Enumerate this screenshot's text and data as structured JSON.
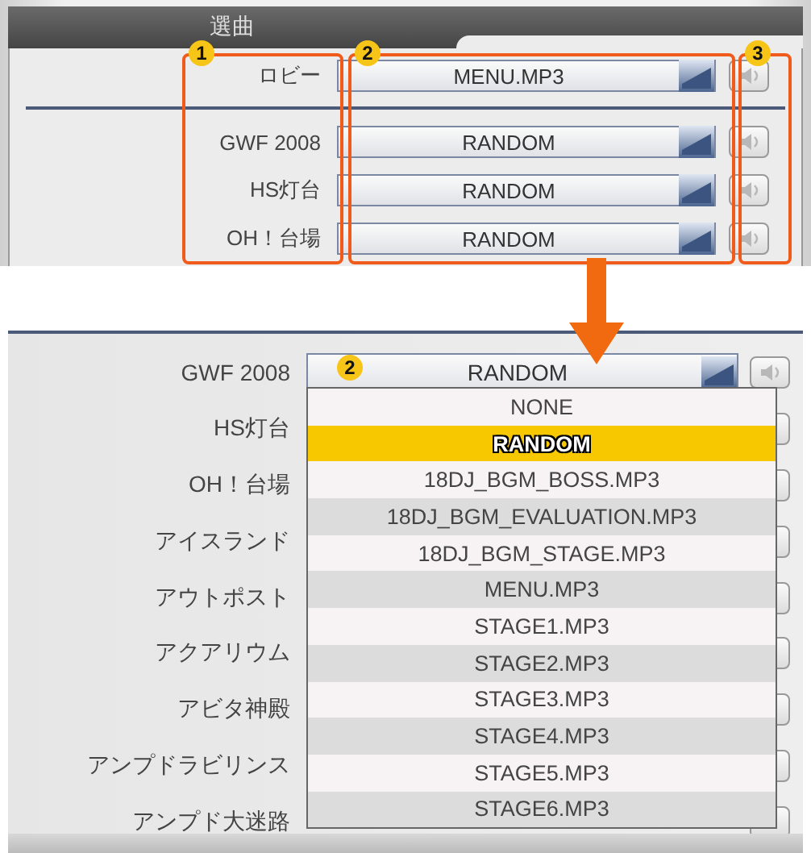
{
  "top_panel": {
    "tab": "選曲",
    "badges": [
      {
        "number": "1"
      },
      {
        "number": "2"
      },
      {
        "number": "3"
      }
    ],
    "lobby_row": {
      "label": "ロビー",
      "value": "MENU.MP3"
    },
    "stage_rows": [
      {
        "label": "GWF 2008",
        "value": "RANDOM"
      },
      {
        "label": "HS灯台",
        "value": "RANDOM"
      },
      {
        "label": "OH！台場",
        "value": "RANDOM"
      }
    ]
  },
  "bottom_panel": {
    "select": {
      "value": "RANDOM",
      "badge": "2"
    },
    "rows": [
      {
        "label": "GWF 2008"
      },
      {
        "label": "HS灯台"
      },
      {
        "label": "OH！台場"
      },
      {
        "label": "アイスランド"
      },
      {
        "label": "アウトポスト"
      },
      {
        "label": "アクアリウム"
      },
      {
        "label": "アビタ神殿"
      },
      {
        "label": "アンプドラビリンス"
      },
      {
        "label": "アンプド大迷路"
      }
    ],
    "dropdown": [
      {
        "label": "NONE",
        "selected": false
      },
      {
        "label": "RANDOM",
        "selected": true
      },
      {
        "label": "18DJ_BGM_BOSS.MP3",
        "selected": false
      },
      {
        "label": "18DJ_BGM_EVALUATION.MP3",
        "selected": false
      },
      {
        "label": "18DJ_BGM_STAGE.MP3",
        "selected": false
      },
      {
        "label": "MENU.MP3",
        "selected": false
      },
      {
        "label": "STAGE1.MP3",
        "selected": false
      },
      {
        "label": "STAGE2.MP3",
        "selected": false
      },
      {
        "label": "STAGE3.MP3",
        "selected": false
      },
      {
        "label": "STAGE4.MP3",
        "selected": false
      },
      {
        "label": "STAGE5.MP3",
        "selected": false
      },
      {
        "label": "STAGE6.MP3",
        "selected": false
      }
    ]
  }
}
